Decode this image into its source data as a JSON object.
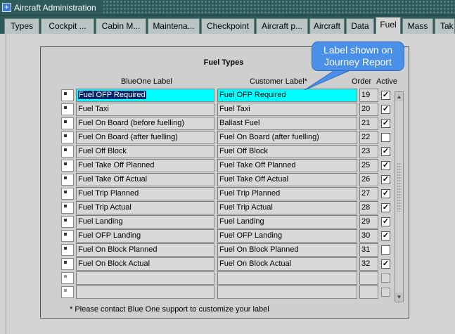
{
  "window": {
    "title": "Aircraft Administration",
    "icon": "app-icon"
  },
  "tabs": [
    {
      "label": "Types"
    },
    {
      "label": "Cockpit ..."
    },
    {
      "label": "Cabin M..."
    },
    {
      "label": "Maintena..."
    },
    {
      "label": "Checkpoint"
    },
    {
      "label": "Aircraft p..."
    },
    {
      "label": "Aircraft"
    },
    {
      "label": "Data"
    },
    {
      "label": "Fuel",
      "active": true
    },
    {
      "label": "Mass"
    },
    {
      "label": "Tak"
    }
  ],
  "panel": {
    "title": "Fuel Types",
    "headers": {
      "blueone_label": "BlueOne Label",
      "customer_label": "Customer Label*",
      "order": "Order",
      "active": "Active"
    },
    "rows": [
      {
        "blueone": "Fuel OFP Required",
        "customer": "Fuel OFP Required",
        "order": "19",
        "active": true,
        "selected": true
      },
      {
        "blueone": "Fuel Taxi",
        "customer": "Fuel Taxi",
        "order": "20",
        "active": true
      },
      {
        "blueone": "Fuel On Board (before fuelling)",
        "customer": "Ballast Fuel",
        "order": "21",
        "active": true
      },
      {
        "blueone": "Fuel On Board (after fuelling)",
        "customer": "Fuel On Board (after fuelling)",
        "order": "22",
        "active": false
      },
      {
        "blueone": "Fuel Off Block",
        "customer": "Fuel Off Block",
        "order": "23",
        "active": true
      },
      {
        "blueone": "Fuel Take Off Planned",
        "customer": "Fuel Take Off Planned",
        "order": "25",
        "active": true
      },
      {
        "blueone": "Fuel Take Off Actual",
        "customer": "Fuel Take Off Actual",
        "order": "26",
        "active": true
      },
      {
        "blueone": "Fuel Trip Planned",
        "customer": "Fuel Trip Planned",
        "order": "27",
        "active": true
      },
      {
        "blueone": "Fuel Trip Actual",
        "customer": "Fuel Trip Actual",
        "order": "28",
        "active": true
      },
      {
        "blueone": "Fuel Landing",
        "customer": "Fuel Landing",
        "order": "29",
        "active": true
      },
      {
        "blueone": "Fuel OFP Landing",
        "customer": "Fuel OFP Landing",
        "order": "30",
        "active": true
      },
      {
        "blueone": "Fuel On Block Planned",
        "customer": "Fuel On Block Planned",
        "order": "31",
        "active": false
      },
      {
        "blueone": "Fuel On Block Actual",
        "customer": "Fuel On Block Actual",
        "order": "32",
        "active": true
      },
      {
        "blueone": "",
        "customer": "",
        "order": "",
        "active": false,
        "empty": true
      },
      {
        "blueone": "",
        "customer": "",
        "order": "",
        "active": false,
        "empty": true
      }
    ],
    "footnote": "* Please contact Blue One support to customize your label"
  },
  "callout": {
    "line1": "Label shown on",
    "line2": "Journey Report"
  },
  "colors": {
    "titlebar": "#2f5a5a",
    "selected_field": "#00ffff",
    "selected_text_bg": "#0a246a",
    "callout": "#4a8fe8"
  }
}
